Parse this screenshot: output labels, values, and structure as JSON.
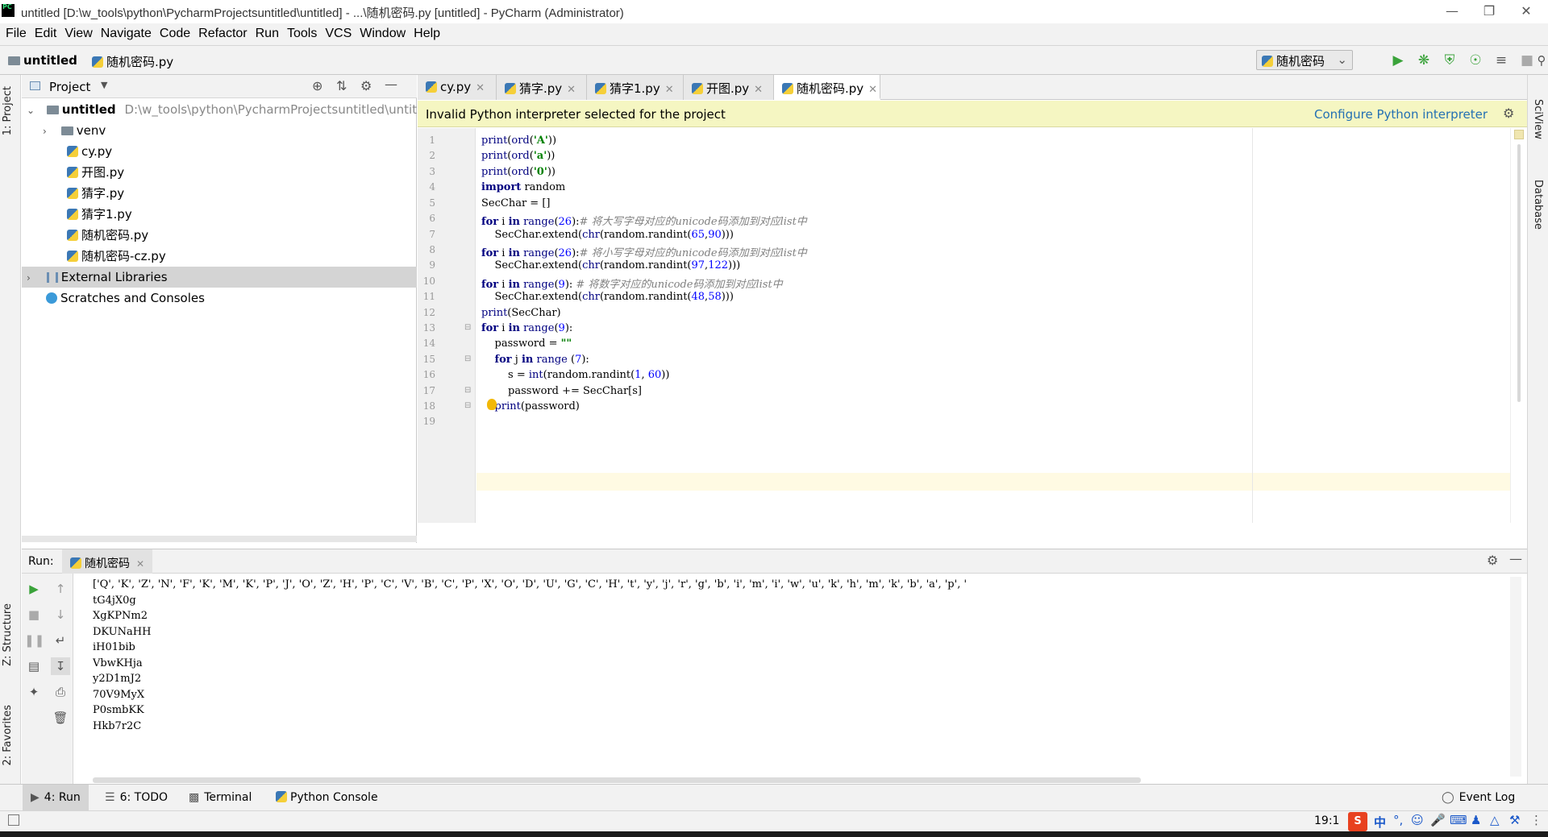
{
  "window": {
    "title": "untitled [D:\\w_tools\\python\\PycharmProjectsuntitled\\untitled] - ...\\随机密码.py [untitled] - PyCharm (Administrator)",
    "app_icon_text": "PC"
  },
  "menu": [
    "File",
    "Edit",
    "View",
    "Navigate",
    "Code",
    "Refactor",
    "Run",
    "Tools",
    "VCS",
    "Window",
    "Help"
  ],
  "navbar": {
    "project": "untitled",
    "file": "随机密码.py",
    "run_config": "随机密码"
  },
  "project_panel": {
    "title": "Project",
    "tab_label": "1: Project",
    "tree": [
      {
        "label": "untitled",
        "path": "D:\\w_tools\\python\\PycharmProjectsuntitled\\untitled",
        "type": "folder"
      },
      {
        "label": "venv",
        "type": "folder"
      },
      {
        "label": "cy.py",
        "type": "py"
      },
      {
        "label": "开图.py",
        "type": "py"
      },
      {
        "label": "猜字.py",
        "type": "py"
      },
      {
        "label": "猜字1.py",
        "type": "py"
      },
      {
        "label": "随机密码.py",
        "type": "py"
      },
      {
        "label": "随机密码-cz.py",
        "type": "py"
      },
      {
        "label": "External Libraries",
        "type": "lib"
      },
      {
        "label": "Scratches and Consoles",
        "type": "scratch"
      }
    ]
  },
  "editor_tabs": [
    "cy.py",
    "猜字.py",
    "猜字1.py",
    "开图.py",
    "随机密码.py"
  ],
  "active_tab": "随机密码.py",
  "banner": {
    "message": "Invalid Python interpreter selected for the project",
    "action": "Configure Python interpreter"
  },
  "code_lines": [
    "print(ord('A'))",
    "print(ord('a'))",
    "print(ord('0'))",
    "import random",
    "SecChar = []",
    "for i in range(26):# 将大写字母对应的unicode码添加到对应list中",
    "    SecChar.extend(chr(random.randint(65,90)))",
    "for i in range(26):# 将小写字母对应的unicode码添加到对应list中",
    "    SecChar.extend(chr(random.randint(97,122)))",
    "for i in range(9): # 将数字对应的unicode码添加到对应list中",
    "    SecChar.extend(chr(random.randint(48,58)))",
    "print(SecChar)",
    "for i in range(9):",
    "    password = \"\"",
    "    for j in range (7):",
    "        s = int(random.randint(1, 60))",
    "        password += SecChar[s]",
    "    print(password)",
    ""
  ],
  "run_panel": {
    "label": "Run:",
    "tab": "随机密码",
    "output": [
      "['Q', 'K', 'Z', 'N', 'F', 'K', 'M', 'K', 'P', 'J', 'O', 'Z', 'H', 'P', 'C', 'V', 'B', 'C', 'P', 'X', 'O', 'D', 'U', 'G', 'C', 'H', 't', 'y', 'j', 'r', 'g', 'b', 'i', 'm', 'i', 'w', 'u', 'k', 'h', 'm', 'k', 'b', 'a', 'p', '",
      "tG4jX0g",
      "XgKPNm2",
      "DKUNaHH",
      "iH01bib",
      "VbwKHja",
      "y2D1mJ2",
      "70V9MyX",
      "P0smbKK",
      "Hkb7r2C"
    ]
  },
  "left_tabs": [
    "1: Project",
    "Z: Structure",
    "2: Favorites"
  ],
  "right_tabs": [
    "SciView",
    "Database"
  ],
  "bottom_tabs": [
    "4: Run",
    "6: TODO",
    "Terminal",
    "Python Console"
  ],
  "event_log": "Event Log",
  "status": {
    "position": "19:1",
    "ime": "中"
  }
}
